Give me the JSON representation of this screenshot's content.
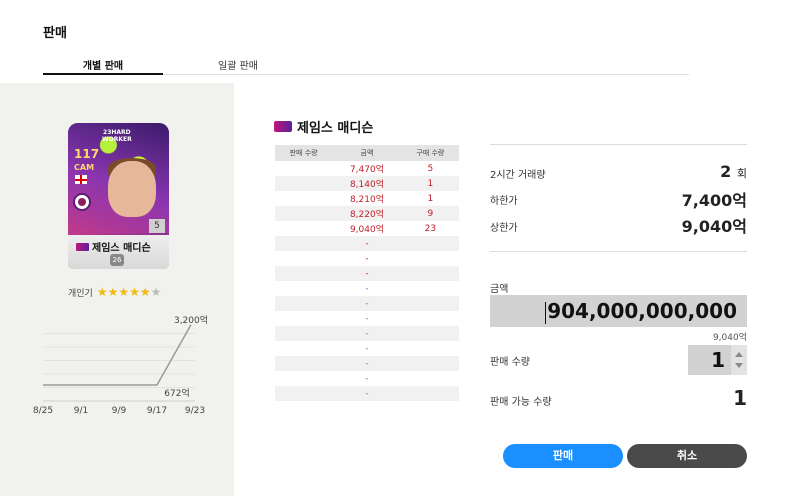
{
  "page": {
    "title": "판매"
  },
  "tabs": [
    {
      "label": "개별 판매",
      "active": true
    },
    {
      "label": "일괄 판매",
      "active": false
    }
  ],
  "card": {
    "badge_line1": "23HARD",
    "badge_line2": "WORKER",
    "ovr": "117",
    "position": "CAM",
    "level": "5",
    "name": "제임스 매디슨",
    "grade": "26"
  },
  "popularity": {
    "label": "개인기",
    "stars": 5,
    "max_stars": 6
  },
  "chart_data": {
    "type": "line",
    "x": [
      "8/25",
      "9/1",
      "9/9",
      "9/17",
      "9/23"
    ],
    "series": [
      {
        "values": [
          672,
          672,
          672,
          672,
          3200
        ]
      }
    ],
    "annotations": [
      "3,200억",
      "672억"
    ],
    "ylim": [
      0,
      3400
    ]
  },
  "player": {
    "name": "제임스 매디슨"
  },
  "orders": {
    "headers": [
      "판매 수량",
      "금액",
      "구매 수량"
    ],
    "rows": [
      {
        "sell": "",
        "price": "7,470억",
        "buy": "5"
      },
      {
        "sell": "",
        "price": "8,140억",
        "buy": "1"
      },
      {
        "sell": "",
        "price": "8,210억",
        "buy": "1"
      },
      {
        "sell": "",
        "price": "8,220억",
        "buy": "9"
      },
      {
        "sell": "",
        "price": "9,040억",
        "buy": "23"
      },
      {
        "sell": "",
        "price": "-",
        "buy": ""
      },
      {
        "sell": "",
        "price": "-",
        "buy": ""
      },
      {
        "sell": "",
        "price": "-",
        "buy": ""
      },
      {
        "sell": "",
        "price": "-",
        "buy": ""
      },
      {
        "sell": "",
        "price": "-",
        "buy": ""
      },
      {
        "sell": "",
        "price": "-",
        "buy": ""
      },
      {
        "sell": "",
        "price": "-",
        "buy": ""
      },
      {
        "sell": "",
        "price": "-",
        "buy": ""
      },
      {
        "sell": "",
        "price": "-",
        "buy": ""
      },
      {
        "sell": "",
        "price": "-",
        "buy": ""
      },
      {
        "sell": "",
        "price": "-",
        "buy": ""
      }
    ]
  },
  "stats": {
    "volume_label": "2시간 거래량",
    "volume_value": "2",
    "volume_unit": "회",
    "min_label": "하한가",
    "min_value": "7,400억",
    "max_label": "상한가",
    "max_value": "9,040억"
  },
  "price": {
    "label": "금액",
    "value": "904,000,000,000",
    "sub": "9,040억"
  },
  "quantity": {
    "label": "판매 수량",
    "value": "1"
  },
  "available": {
    "label": "판매 가능 수량",
    "value": "1"
  },
  "buttons": {
    "sell": "판매",
    "cancel": "취소"
  },
  "colors": {
    "sell_button": "#1a8fff",
    "cancel_button": "#4a4a4a",
    "price_red": "#c0202a",
    "dash_blue": "#3a8fd8",
    "star": "#f2b90f"
  }
}
